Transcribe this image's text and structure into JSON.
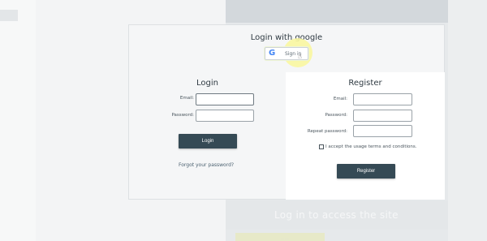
{
  "background": {
    "ghost_text": "Log in to access the site",
    "bottom_strip_text": "...."
  },
  "modal": {
    "google_title": "Login with google",
    "google_button": {
      "icon": "google-g-icon",
      "glyph": "G",
      "label": "Sign in"
    }
  },
  "login": {
    "title": "Login",
    "email_label": "Email:",
    "password_label": "Password:",
    "email_value": "",
    "password_value": "",
    "submit_label": "Login",
    "forgot_link": "Forgot your password?"
  },
  "register": {
    "title": "Register",
    "email_label": "Email:",
    "password_label": "Password:",
    "repeat_label": "Repeat password:",
    "terms_label": "I accept the usage terms and conditions.",
    "terms_checked": false,
    "submit_label": "Register"
  },
  "colors": {
    "button_bg": "#354a55",
    "google_blue": "#4285f4",
    "highlight": "#faf7a0"
  }
}
